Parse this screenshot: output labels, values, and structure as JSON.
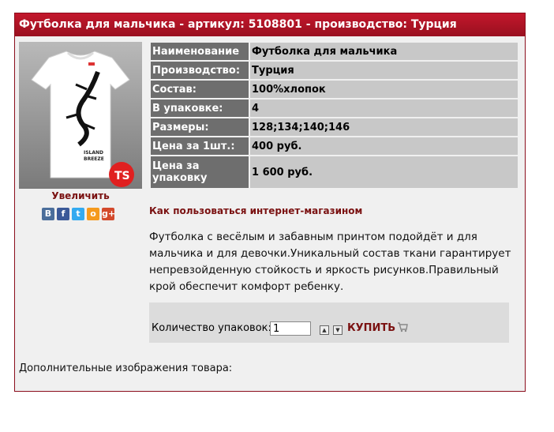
{
  "header": {
    "title": "Футболка для мальчика - артикул: 5108801 - производство: Турция"
  },
  "product": {
    "zoom_label": "Увеличить",
    "print_text_line1": "ISLAND",
    "print_text_line2": "BREEZE",
    "brand_badge": "TS"
  },
  "social": [
    {
      "name": "vk",
      "glyph": "В",
      "color": "#4b6e9b"
    },
    {
      "name": "facebook",
      "glyph": "f",
      "color": "#3b5998"
    },
    {
      "name": "twitter",
      "glyph": "t",
      "color": "#33aaf0"
    },
    {
      "name": "odnoklassniki",
      "glyph": "о",
      "color": "#f59a1d"
    },
    {
      "name": "google-plus",
      "glyph": "g+",
      "color": "#d3492c"
    }
  ],
  "specs": [
    {
      "key": "Наименование",
      "value": "Футболка для мальчика"
    },
    {
      "key": "Производство:",
      "value": "Турция"
    },
    {
      "key": "Состав:",
      "value": "100%хлопок"
    },
    {
      "key": "В упаковке:",
      "value": "4"
    },
    {
      "key": "Размеры:",
      "value": "128;134;140;146"
    },
    {
      "key": "Цена за 1шт.:",
      "value": "400 руб."
    },
    {
      "key": "Цена за упаковку",
      "value": "1 600 руб."
    }
  ],
  "howto_link": "Как пользоваться интернет-магазином",
  "description": "Футболка с весёлым и забавным  принтом подойдёт и для мальчика и для девочки.Уникальный состав ткани гарантирует непревзойденную стойкость и яркость рисунков.Правильный крой обеспечит комфорт ребенку.",
  "buy": {
    "qty_label": "Количество упаковок:",
    "qty_value": "1",
    "buy_label": "КУПИТЬ"
  },
  "extra_label": "Дополнительные изображения товара:"
}
